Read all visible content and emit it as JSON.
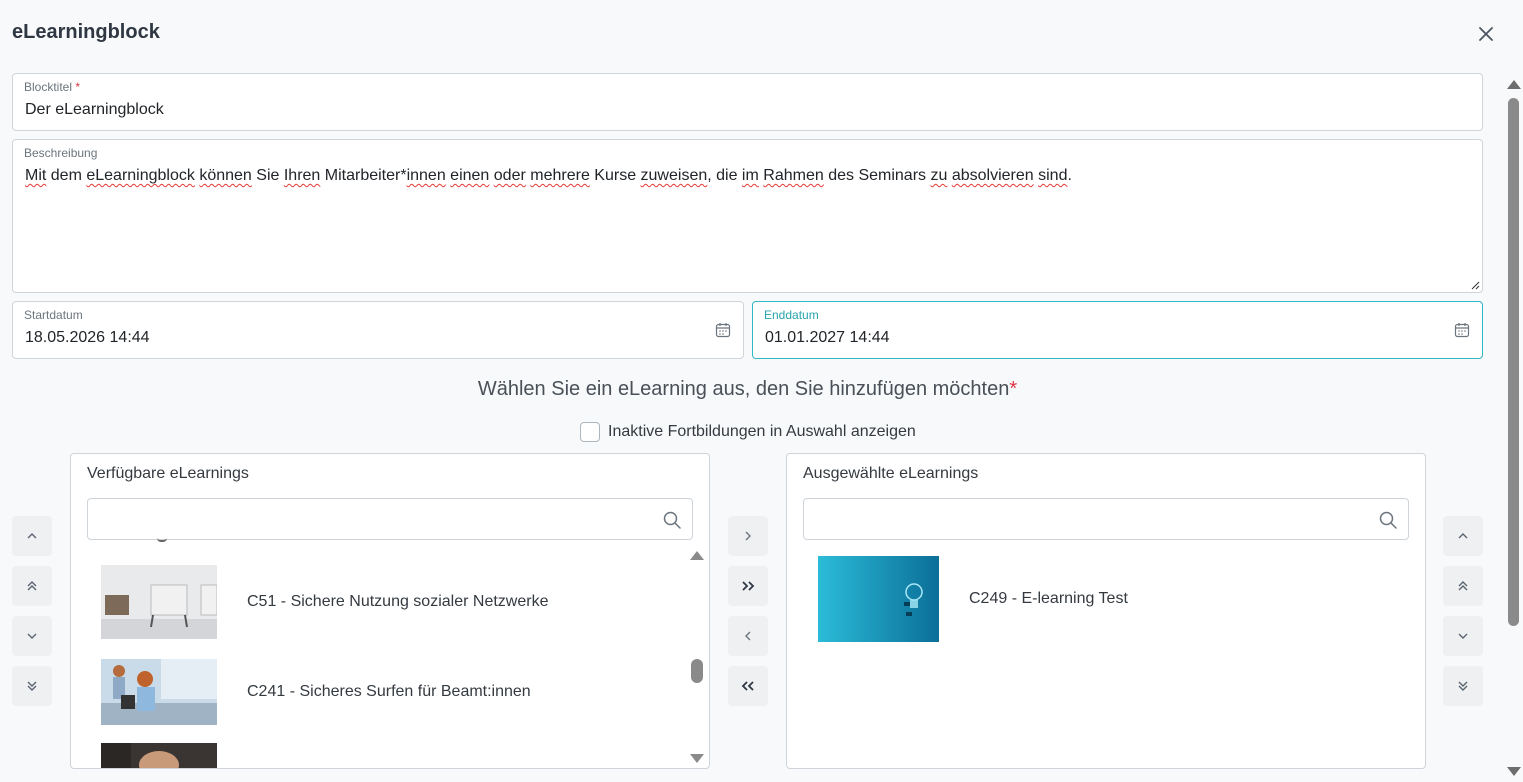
{
  "dialog": {
    "title": "eLearningblock"
  },
  "form": {
    "blocktitel": {
      "label": "Blocktitel",
      "required_mark": "*",
      "value": "Der eLearningblock"
    },
    "beschreibung": {
      "label": "Beschreibung",
      "value_parts": [
        {
          "text": "Mit",
          "misspelled": true
        },
        {
          "text": " dem ",
          "misspelled": false
        },
        {
          "text": "eLearningblock",
          "misspelled": true
        },
        {
          "text": " ",
          "misspelled": false
        },
        {
          "text": "können",
          "misspelled": true
        },
        {
          "text": " Sie ",
          "misspelled": false
        },
        {
          "text": "Ihren",
          "misspelled": true
        },
        {
          "text": " Mitarbeiter*",
          "misspelled": false
        },
        {
          "text": "innen",
          "misspelled": true
        },
        {
          "text": " ",
          "misspelled": false
        },
        {
          "text": "einen",
          "misspelled": true
        },
        {
          "text": " ",
          "misspelled": false
        },
        {
          "text": "oder",
          "misspelled": true
        },
        {
          "text": " ",
          "misspelled": false
        },
        {
          "text": "mehrere",
          "misspelled": true
        },
        {
          "text": " Kurse ",
          "misspelled": false
        },
        {
          "text": "zuweisen",
          "misspelled": true
        },
        {
          "text": ", die ",
          "misspelled": false
        },
        {
          "text": "im",
          "misspelled": true
        },
        {
          "text": " ",
          "misspelled": false
        },
        {
          "text": "Rahmen",
          "misspelled": true
        },
        {
          "text": " des Seminars ",
          "misspelled": false
        },
        {
          "text": "zu",
          "misspelled": true
        },
        {
          "text": " ",
          "misspelled": false
        },
        {
          "text": "absolvieren",
          "misspelled": true
        },
        {
          "text": " ",
          "misspelled": false
        },
        {
          "text": "sind",
          "misspelled": true
        },
        {
          "text": ".",
          "misspelled": false
        }
      ]
    },
    "startdatum": {
      "label": "Startdatum",
      "value": "18.05.2026 14:44"
    },
    "enddatum": {
      "label": "Enddatum",
      "value": "01.01.2027 14:44"
    }
  },
  "selection": {
    "heading": "Wählen Sie ein eLearning aus, den Sie hinzufügen möchten",
    "required_mark": "*",
    "inactive_checkbox_label": "Inaktive Fortbildungen in Auswahl anzeigen",
    "inactive_checked": false
  },
  "available": {
    "title": "Verfügbare eLearnings",
    "search_placeholder": "",
    "items": [
      {
        "label": "C51 - Sichere Nutzung sozialer Netzwerke",
        "thumb": "office-chairs"
      },
      {
        "label": "C241 - Sicheres Surfen für Beamt:innen",
        "thumb": "office-workers"
      },
      {
        "label": "",
        "thumb": "portrait"
      }
    ],
    "scroll_position": 0.45
  },
  "selected": {
    "title": "Ausgewählte eLearnings",
    "search_placeholder": "",
    "items": [
      {
        "label": "C249 - E-learning Test",
        "thumb": "lightbulb"
      }
    ]
  },
  "colors": {
    "accent": "#2fb8c4",
    "required": "#dc3545",
    "button_bg": "#eef0f2"
  },
  "icons": {
    "close": "close-icon",
    "calendar": "calendar-icon",
    "search": "search-icon",
    "move_right": "chevron-right-icon",
    "move_all_right": "chevrons-right-icon",
    "move_left": "chevron-left-icon",
    "move_all_left": "chevrons-left-icon",
    "up": "chevron-up-icon",
    "top": "chevrons-up-icon",
    "down": "chevron-down-icon",
    "bottom": "chevrons-down-icon"
  }
}
